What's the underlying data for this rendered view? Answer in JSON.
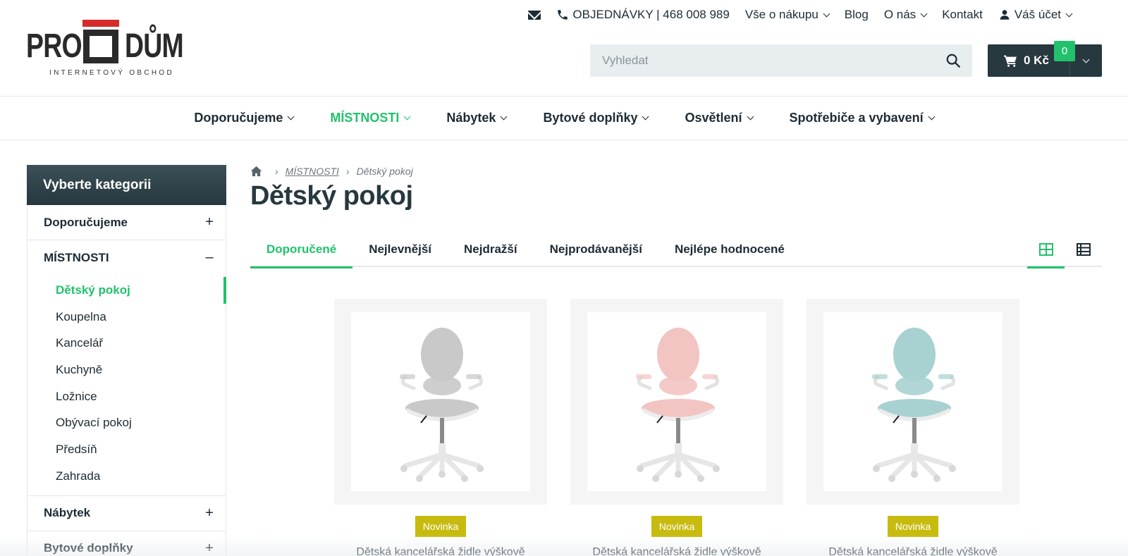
{
  "logo": {
    "word_left": "PRO",
    "word_right": "DŮM",
    "subtitle": "INTERNETOVÝ OBCHOD"
  },
  "topnav": {
    "orders_label": "OBJEDNÁVKY | 468 008 989",
    "items": [
      "Vše o nákupu",
      "Blog",
      "O nás",
      "Kontakt",
      "Váš účet"
    ]
  },
  "search": {
    "placeholder": "Vyhledat",
    "value": ""
  },
  "cart": {
    "total": "0 Kč",
    "count": "0"
  },
  "mainnav": {
    "items": [
      "Doporučujeme",
      "MÍSTNOSTI",
      "Nábytek",
      "Bytové doplňky",
      "Osvětlení",
      "Spotřebiče a vybavení"
    ],
    "active": "MÍSTNOSTI"
  },
  "sidebar": {
    "title": "Vyberte kategorii",
    "groups": [
      {
        "label": "Doporučujeme",
        "toggle": "+"
      },
      {
        "label": "MÍSTNOSTI",
        "toggle": "–",
        "children": [
          "Dětský pokoj",
          "Koupelna",
          "Kancelář",
          "Kuchyně",
          "Ložnice",
          "Obývací pokoj",
          "Předsíň",
          "Zahrada"
        ],
        "active_child": "Dětský pokoj"
      },
      {
        "label": "Nábytek",
        "toggle": "+"
      },
      {
        "label": "Bytové doplňky",
        "toggle": "+"
      }
    ]
  },
  "breadcrumb": {
    "parent": "MÍSTNOSTI",
    "current": "Dětský pokoj"
  },
  "page_title": "Dětský pokoj",
  "sort_tabs": {
    "items": [
      "Doporučené",
      "Nejlevnější",
      "Nejdražší",
      "Nejprodávanější",
      "Nejlépe hodnocené"
    ],
    "active": "Doporučené"
  },
  "view_modes": {
    "options": [
      "grid-icon",
      "list-icon"
    ],
    "active": "grid-icon"
  },
  "products": [
    {
      "badge": "Novinka",
      "name": "Dětská kancelářská židle výškově",
      "color": "#c9c9c9"
    },
    {
      "badge": "Novinka",
      "name": "Dětská kancelářská židle výškově",
      "color": "#f2c4c2"
    },
    {
      "badge": "Novinka",
      "name": "Dětská kancelářská židle výškově",
      "color": "#a8d1d1"
    }
  ],
  "colors": {
    "accent": "#21c26b",
    "dark": "#27383f",
    "logo_red": "#d52b2b",
    "badge": "#c8bb10"
  }
}
